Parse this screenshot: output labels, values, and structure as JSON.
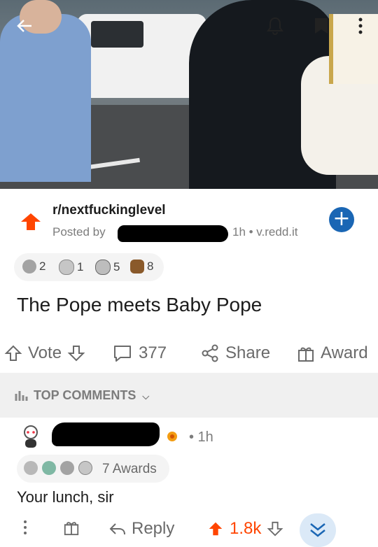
{
  "post": {
    "subreddit": "r/nextfuckinglevel",
    "posted_by_label": "Posted by",
    "age_domain": "1h • v.redd.it",
    "title": "The Pope meets Baby Pope",
    "awards": [
      {
        "icon": "award-icon-1",
        "count": "2",
        "color": "#9a9a9a"
      },
      {
        "icon": "award-icon-2",
        "count": "1",
        "color": "#b0b0b0"
      },
      {
        "icon": "award-icon-3",
        "count": "5",
        "color": "#8e8e8e"
      },
      {
        "icon": "award-icon-4",
        "count": "8",
        "color": "#8a5a2b"
      }
    ]
  },
  "actions": {
    "vote_label": "Vote",
    "comments_count": "377",
    "share_label": "Share",
    "award_label": "Award"
  },
  "sort": {
    "label": "TOP COMMENTS"
  },
  "comment": {
    "time": "• 1h",
    "awards_label": "7 Awards",
    "body": "Your lunch, sir",
    "reply_label": "Reply",
    "score": "1.8k"
  },
  "colors": {
    "upvote": "#ff4500",
    "join_blue": "#1a66b4",
    "muted": "#7c7c7c"
  }
}
